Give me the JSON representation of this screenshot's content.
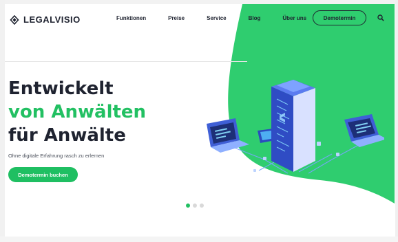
{
  "brand": {
    "name": "LEGALVISIO",
    "logo_icon": "diamond-outline-icon"
  },
  "nav": {
    "items": [
      "Funktionen",
      "Preise",
      "Service",
      "Blog",
      "Über uns"
    ],
    "demo_button": "Demotermin",
    "search_icon": "search-icon"
  },
  "hero": {
    "line1": "Entwickelt",
    "line2": "von Anwälten",
    "line3": "für Anwälte",
    "subtitle": "Ohne digitale Erfahrung rasch zu erlernen",
    "cta": "Demotermin buchen"
  },
  "carousel": {
    "slides": 3,
    "active": 1
  },
  "colors": {
    "accent_green": "#22c062",
    "text_dark": "#1f2330",
    "server_blue": "#3f5fd6"
  }
}
